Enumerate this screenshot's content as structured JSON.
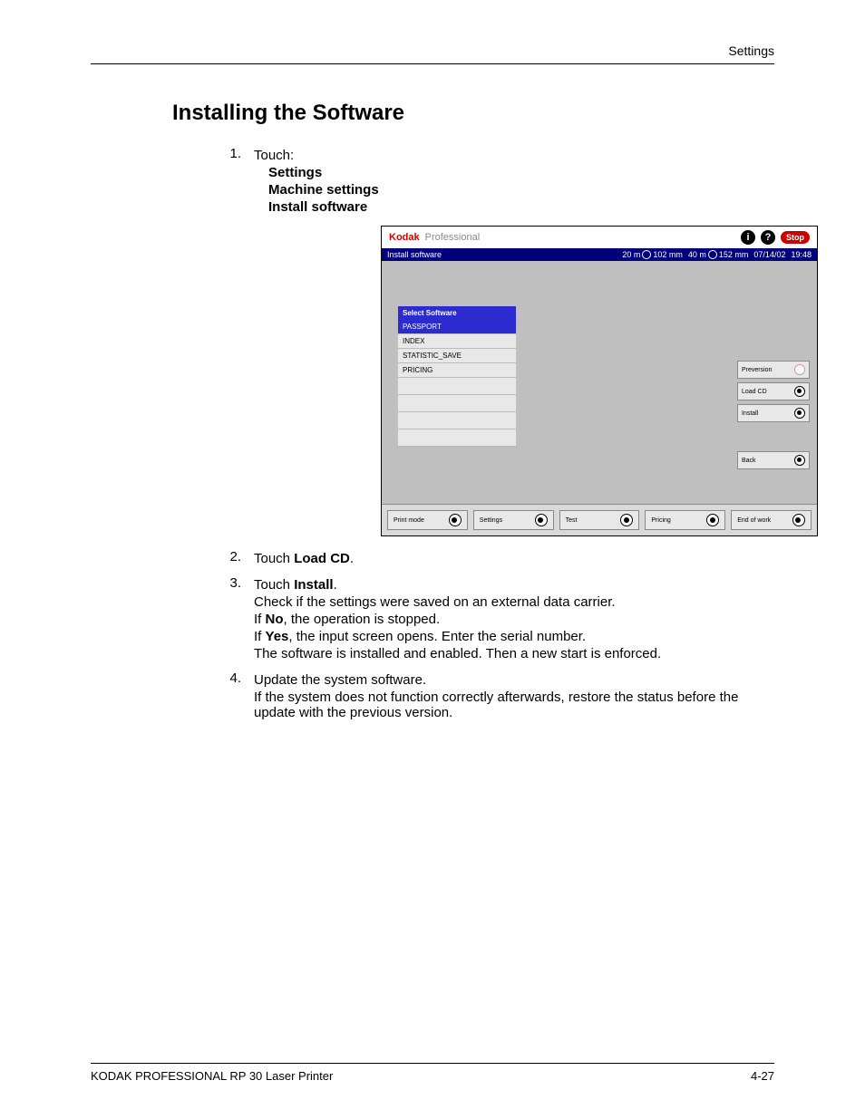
{
  "header": {
    "running": "Settings"
  },
  "title": "Installing the Software",
  "steps": {
    "s1": {
      "num": "1.",
      "lead": "Touch:",
      "items": [
        "Settings",
        "Machine settings",
        "Install software"
      ]
    },
    "s2": {
      "num": "2.",
      "pre": "Touch ",
      "bold": "Load CD",
      "post": "."
    },
    "s3": {
      "num": "3.",
      "pre": "Touch ",
      "bold": "Install",
      "post": ".",
      "l1": "Check if the settings were saved on an external data carrier.",
      "l2a": "If ",
      "l2b": "No",
      "l2c": ", the operation is stopped.",
      "l3a": "If ",
      "l3b": "Yes",
      "l3c": ", the input screen opens. Enter the serial number.",
      "l4": "The software is installed and enabled. Then a new start is enforced."
    },
    "s4": {
      "num": "4.",
      "l1": "Update the system software.",
      "l2": "If the system does not function correctly afterwards, restore the status before the update with the previous version."
    }
  },
  "ui": {
    "brand1": "Kodak",
    "brand2": "Professional",
    "info_glyph": "i",
    "help_glyph": "?",
    "stop": "Stop",
    "titlebar": "Install software",
    "status": {
      "p1a": "20 m",
      "p1b": "102 mm",
      "p2a": "40 m",
      "p2b": "152 mm",
      "date": "07/14/02",
      "time": "19:48"
    },
    "list": {
      "header": "Select Software",
      "items": [
        "PASSPORT",
        "INDEX",
        "STATISTIC_SAVE",
        "PRICING"
      ]
    },
    "side": {
      "preversion": "Preversion",
      "loadcd": "Load CD",
      "install": "Install",
      "back": "Back"
    },
    "bottom": {
      "printmode": "Print mode",
      "settings": "Settings",
      "test": "Test",
      "pricing": "Pricing",
      "endofwork": "End of work"
    }
  },
  "footer": {
    "left": "KODAK PROFESSIONAL RP 30 Laser Printer",
    "right": "4-27"
  }
}
